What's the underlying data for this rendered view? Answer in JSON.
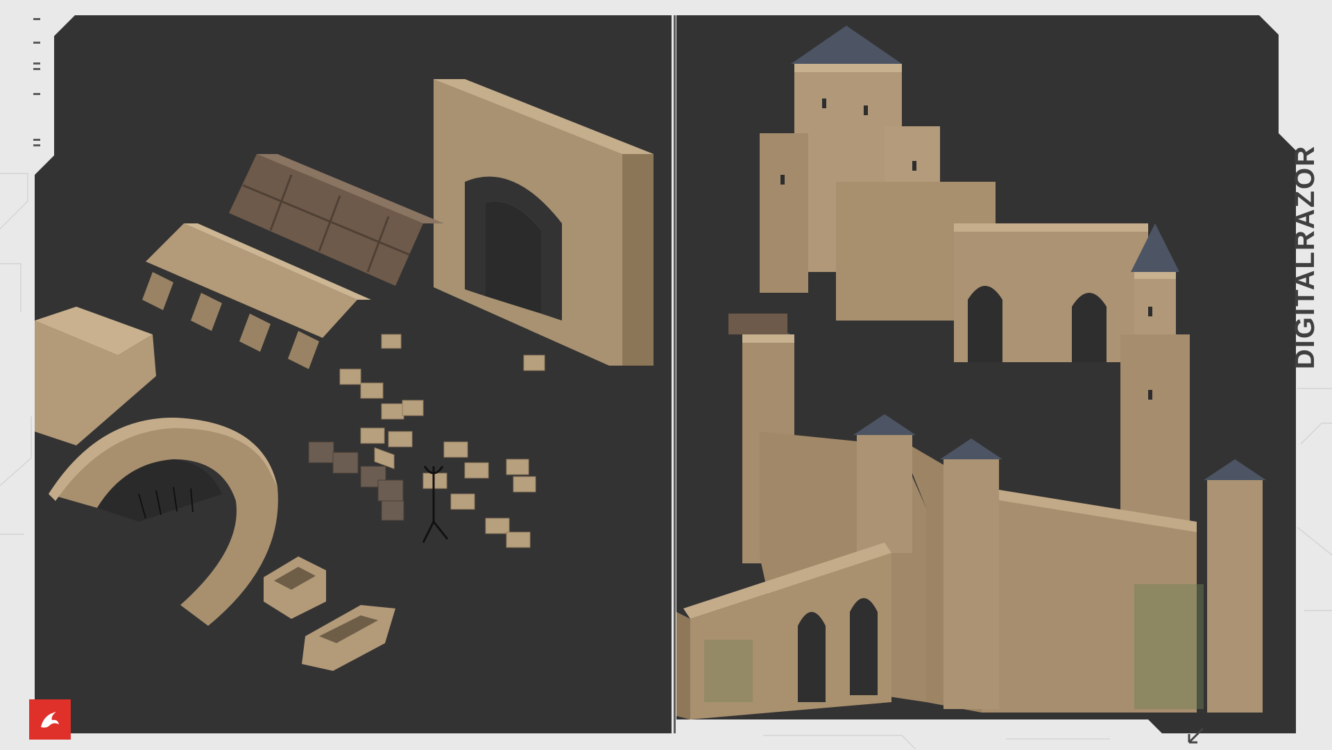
{
  "brand": {
    "text": "DIGITALRAZOR",
    "color": "#3f3f3f"
  },
  "logo": {
    "icon": "red-raptor-logo-icon",
    "color": "#e0302a"
  },
  "colors": {
    "viewport": "#333333",
    "frame": "#e9e9e9",
    "stone": "#b39a78",
    "wood": "#6e5a4a",
    "slate": "#4d5564"
  },
  "icons": {
    "corner": "arrow-down-left-icon"
  }
}
